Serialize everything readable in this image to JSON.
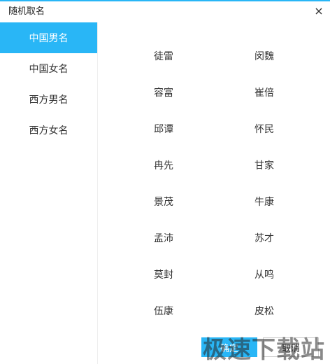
{
  "window": {
    "title": "随机取名"
  },
  "icons": {
    "close": "close-icon"
  },
  "sidebar": {
    "items": [
      {
        "label": "中国男名",
        "active": true
      },
      {
        "label": "中国女名",
        "active": false
      },
      {
        "label": "西方男名",
        "active": false
      },
      {
        "label": "西方女名",
        "active": false
      }
    ]
  },
  "names": {
    "rows": [
      [
        "徒雷",
        "闵魏"
      ],
      [
        "容富",
        "崔倍"
      ],
      [
        "邱谭",
        "怀民"
      ],
      [
        "冉先",
        "甘家"
      ],
      [
        "景茂",
        "牛康"
      ],
      [
        "孟沛",
        "苏才"
      ],
      [
        "莫封",
        "从鸣"
      ],
      [
        "伍康",
        "皮松"
      ]
    ]
  },
  "footer": {
    "ok_label": "确定",
    "cancel_label": "取消"
  },
  "watermark": "极速下载站",
  "colors": {
    "accent": "#29b6f6",
    "text": "#333333",
    "divider": "#eeeeee"
  }
}
